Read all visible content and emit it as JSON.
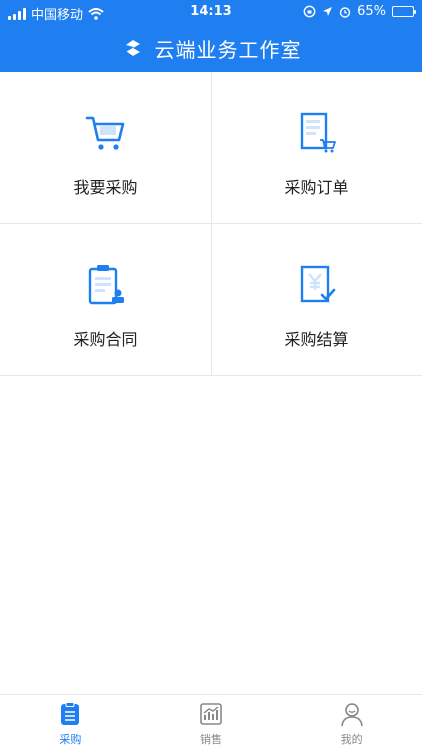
{
  "status_bar": {
    "carrier": "中国移动",
    "time": "14:13",
    "battery": "65%",
    "battery_level": 0.65,
    "icons": [
      "signal-icon",
      "wifi-icon",
      "orientation-lock-icon",
      "location-icon",
      "alarm-icon",
      "battery-icon"
    ]
  },
  "header": {
    "title": "云端业务工作室",
    "logo_icon": "s-logo-icon",
    "accent_color": "#1f7ff0"
  },
  "menu": {
    "items": [
      {
        "label": "我要采购",
        "icon": "shopping-cart-icon"
      },
      {
        "label": "采购订单",
        "icon": "order-document-icon"
      },
      {
        "label": "采购合同",
        "icon": "contract-clipboard-icon"
      },
      {
        "label": "采购结算",
        "icon": "settlement-document-icon"
      }
    ]
  },
  "tabbar": {
    "tabs": [
      {
        "label": "采购",
        "icon": "purchase-list-icon",
        "active": true
      },
      {
        "label": "销售",
        "icon": "sales-chart-icon",
        "active": false
      },
      {
        "label": "我的",
        "icon": "profile-icon",
        "active": false
      }
    ]
  }
}
